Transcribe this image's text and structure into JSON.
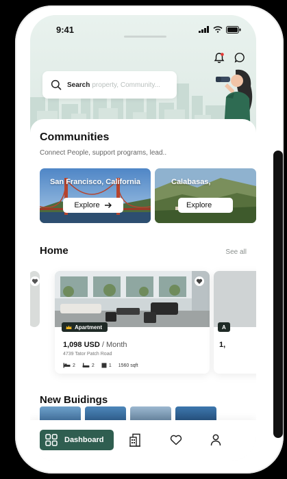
{
  "status_bar": {
    "time": "9:41"
  },
  "search": {
    "label": "Search",
    "placeholder": "property, Community..."
  },
  "communities": {
    "title": "Communities",
    "subtitle": "Connect People, support programs, lead..",
    "cards": [
      {
        "name": "San Francisco, California",
        "button": "Explore"
      },
      {
        "name": "Calabasas,",
        "button": "Explore"
      }
    ]
  },
  "home": {
    "title": "Home",
    "see_all": "See all",
    "listing": {
      "badge": "Apartment",
      "price": "1,098 USD",
      "period": " / Month",
      "address": "4739  Tator Patch Road",
      "beds": "2",
      "baths": "2",
      "floors": "1",
      "area": "1560 sqft"
    },
    "next_listing_price_fragment": "1,",
    "next_listing_badge_fragment": "A"
  },
  "new_buildings": {
    "title": "New Buidings"
  },
  "nav": {
    "dashboard_label": "Dashboard"
  },
  "colors": {
    "accent": "#39c08c",
    "primary": "#2f5e50",
    "hero_bg": "#e4efea"
  }
}
